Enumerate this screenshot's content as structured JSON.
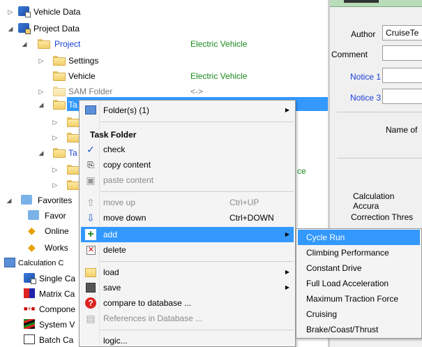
{
  "tree": {
    "vehicle_data": "Vehicle Data",
    "project_data": "Project Data",
    "project": {
      "label": "Project",
      "value": "Electric Vehicle"
    },
    "settings": "Settings",
    "vehicle": {
      "label": "Vehicle",
      "value": "Electric Vehicle"
    },
    "sam_folder": {
      "label": "SAM Folder",
      "value": "<->"
    },
    "task_folder_1": "Ta",
    "task_folder_2": "Ta",
    "partial_value": "ce",
    "favorites": "Favorites",
    "favor": "Favor",
    "online": "Online",
    "works": "Works",
    "calculation": "Calculation C",
    "single_ca": "Single Ca",
    "matrix_ca": "Matrix Ca",
    "compone": "Compone",
    "system_v": "System V",
    "batch_ca": "Batch Ca"
  },
  "form": {
    "author_label": "Author",
    "author_value": "CruiseTe",
    "comment_label": "Comment",
    "notice1_label": "Notice 1",
    "notice3_label": "Notice 3",
    "name_label": "Name of",
    "calc_accuracy_label": "Calculation Accura",
    "correction_label": "Correction Thres"
  },
  "context_menu": {
    "folders": "Folder(s) (1)",
    "header": "Task Folder",
    "check": "check",
    "copy_content": "copy content",
    "paste_content": "paste content",
    "move_up": "move up",
    "move_up_shortcut": "Ctrl+UP",
    "move_down": "move down",
    "move_down_shortcut": "Ctrl+DOWN",
    "add": "add",
    "delete": "delete",
    "load": "load",
    "save": "save",
    "compare": "compare to database ...",
    "references": "References in Database ...",
    "logic": "logic..."
  },
  "submenu": {
    "items": [
      "Cycle Run",
      "Climbing Performance",
      "Constant Drive",
      "Full Load Acceleration",
      "Maximum Traction Force",
      "Cruising",
      "Brake/Coast/Thrust"
    ]
  }
}
